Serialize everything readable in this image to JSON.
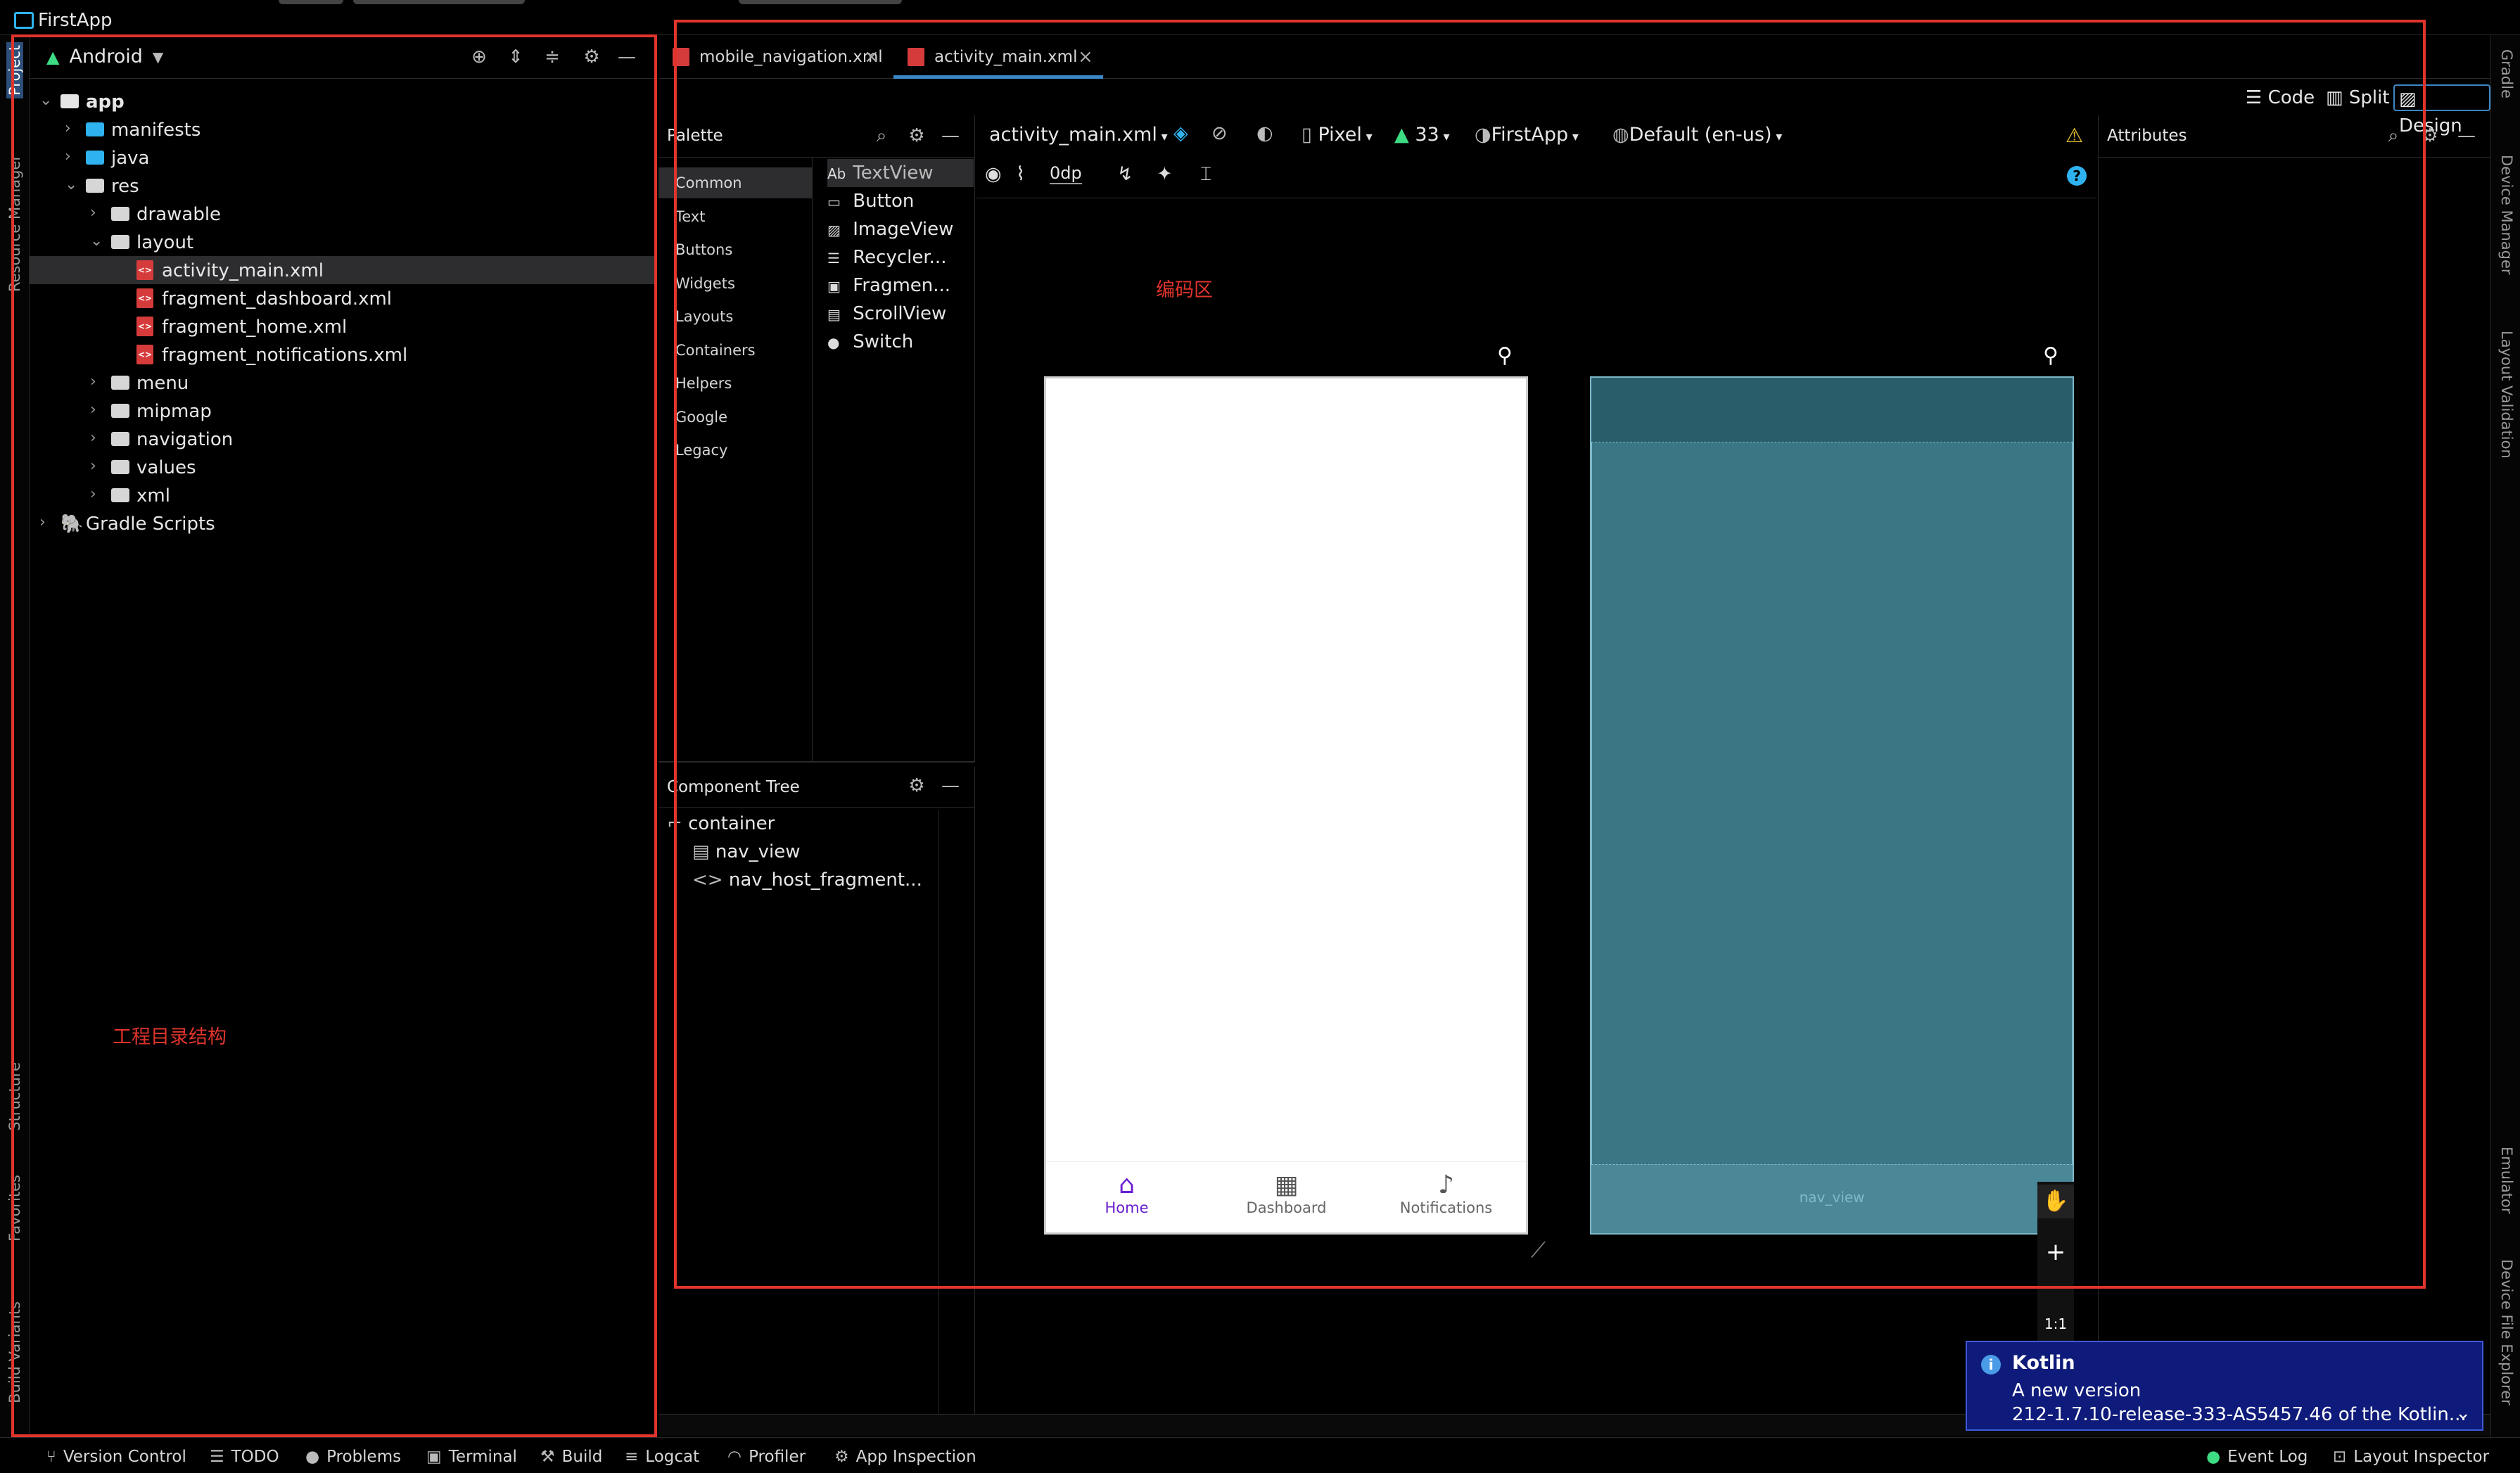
{
  "window": {
    "title": "FirstApp"
  },
  "left_strip": {
    "items": [
      "Project",
      "Resource Manager",
      "Structure",
      "Favorites",
      "Build Variants"
    ]
  },
  "right_strip": {
    "items": [
      "Gradle",
      "Device Manager",
      "Layout Validation",
      "Emulator",
      "Device File Explorer"
    ]
  },
  "project": {
    "view_mode": "Android",
    "tree": [
      {
        "label": "app",
        "depth": 0,
        "type": "module",
        "expanded": true
      },
      {
        "label": "manifests",
        "depth": 1,
        "type": "folder-blue",
        "expanded": false
      },
      {
        "label": "java",
        "depth": 1,
        "type": "folder-blue",
        "expanded": false
      },
      {
        "label": "res",
        "depth": 1,
        "type": "folder-res",
        "expanded": true
      },
      {
        "label": "drawable",
        "depth": 2,
        "type": "folder",
        "expanded": false
      },
      {
        "label": "layout",
        "depth": 2,
        "type": "folder",
        "expanded": true
      },
      {
        "label": "activity_main.xml",
        "depth": 3,
        "type": "xml",
        "selected": true
      },
      {
        "label": "fragment_dashboard.xml",
        "depth": 3,
        "type": "xml"
      },
      {
        "label": "fragment_home.xml",
        "depth": 3,
        "type": "xml"
      },
      {
        "label": "fragment_notifications.xml",
        "depth": 3,
        "type": "xml"
      },
      {
        "label": "menu",
        "depth": 2,
        "type": "folder",
        "expanded": false
      },
      {
        "label": "mipmap",
        "depth": 2,
        "type": "folder",
        "expanded": false
      },
      {
        "label": "navigation",
        "depth": 2,
        "type": "folder",
        "expanded": false
      },
      {
        "label": "values",
        "depth": 2,
        "type": "folder",
        "expanded": false
      },
      {
        "label": "xml",
        "depth": 2,
        "type": "folder",
        "expanded": false
      },
      {
        "label": "Gradle Scripts",
        "depth": 0,
        "type": "gradle",
        "expanded": false
      }
    ],
    "annotation": "工程目录结构"
  },
  "editor": {
    "tabs": [
      {
        "label": "mobile_navigation.xml",
        "active": false
      },
      {
        "label": "activity_main.xml",
        "active": true
      }
    ],
    "view_modes": {
      "code": "Code",
      "split": "Split",
      "design": "Design"
    },
    "annotation": "编码区"
  },
  "palette": {
    "title": "Palette",
    "categories": [
      "Common",
      "Text",
      "Buttons",
      "Widgets",
      "Layouts",
      "Containers",
      "Helpers",
      "Google",
      "Legacy"
    ],
    "items": [
      {
        "icon": "Ab",
        "label": "TextView"
      },
      {
        "icon": "▭",
        "label": "Button"
      },
      {
        "icon": "▨",
        "label": "ImageView"
      },
      {
        "icon": "☰",
        "label": "Recycler..."
      },
      {
        "icon": "▣",
        "label": "Fragmen..."
      },
      {
        "icon": "▤",
        "label": "ScrollView"
      },
      {
        "icon": "●",
        "label": "Switch"
      }
    ]
  },
  "component_tree": {
    "title": "Component Tree",
    "items": [
      {
        "label": "container",
        "depth": 0
      },
      {
        "label": "nav_view",
        "depth": 1
      },
      {
        "label": "nav_host_fragment...",
        "depth": 1
      }
    ]
  },
  "design_toolbar": {
    "file": "activity_main.xml",
    "device": "Pixel",
    "api": "33",
    "theme": "FirstApp",
    "locale": "Default (en-us)",
    "margin": "0dp"
  },
  "preview": {
    "bottom_nav": [
      {
        "label": "Home",
        "icon": "home-icon",
        "active": true
      },
      {
        "label": "Dashboard",
        "icon": "dashboard-icon",
        "active": false
      },
      {
        "label": "Notifications",
        "icon": "bell-icon",
        "active": false
      }
    ],
    "blueprint_label": "nav_view",
    "zoom": {
      "plus": "+",
      "fit": "1:1"
    }
  },
  "attributes": {
    "title": "Attributes"
  },
  "notification": {
    "title": "Kotlin",
    "line1": "A new version",
    "line2": "212-1.7.10-release-333-AS5457.46 of the Kotlin..."
  },
  "statusbar": {
    "items": [
      "Version Control",
      "TODO",
      "Problems",
      "Terminal",
      "Build",
      "Logcat",
      "Profiler",
      "App Inspection"
    ],
    "right": [
      "Event Log",
      "Layout Inspector"
    ]
  },
  "colors": {
    "accent": "#3d86c6",
    "annotation_red": "#e0342c",
    "nav_active": "#6a1fd1",
    "blueprint": "#3a7684"
  }
}
